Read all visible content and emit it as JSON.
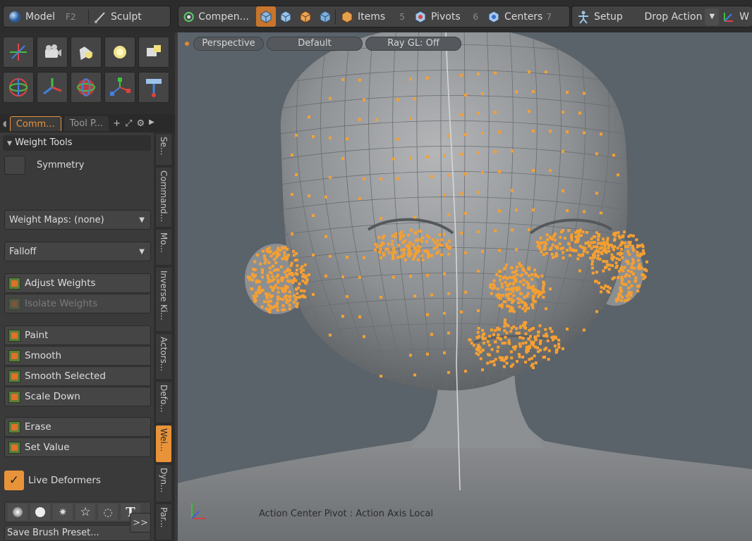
{
  "toolbar": {
    "model_label": "Model",
    "model_key": "F2",
    "sculpt_label": "Sculpt",
    "compen_label": "Compen...",
    "items_label": "Items",
    "items_key": "5",
    "pivots_label": "Pivots",
    "pivots_key": "6",
    "centers_label": "Centers",
    "centers_key": "7",
    "setup_label": "Setup",
    "drop_action_label": "Drop Action",
    "work_label": "W"
  },
  "left_tabs": {
    "commands_label": "Comm...",
    "tool_props_label": "Tool P..."
  },
  "weight_tools": {
    "header": "Weight Tools",
    "symmetry_label": "Symmetry",
    "weight_maps_label": "Weight Maps: (none)",
    "falloff_label": "Falloff",
    "adjust_weights": "Adjust Weights",
    "isolate_weights": "Isolate Weights",
    "paint": "Paint",
    "smooth": "Smooth",
    "smooth_selected": "Smooth Selected",
    "scale_down": "Scale Down",
    "erase": "Erase",
    "set_value": "Set Value",
    "live_deformers": "Live Deformers",
    "save_brush_preset": "Save Brush Preset...",
    "more_label": ">>"
  },
  "vertical_tabs": [
    "Se...",
    "Command...",
    "Mo...",
    "Inverse Ki...",
    "Actors...",
    "Defo...",
    "Wei...",
    "Dyn...",
    "Par..."
  ],
  "viewport": {
    "view_label": "Perspective",
    "style_label": "Default",
    "raygl_label": "Ray GL: Off",
    "status_text": "Action Center Pivot : Action Axis Local"
  },
  "colors": {
    "accent": "#e8933a",
    "viewport_bg": "#5a626a",
    "vertex_color": "#f5a033",
    "mesh_color": "#8a8d90"
  }
}
